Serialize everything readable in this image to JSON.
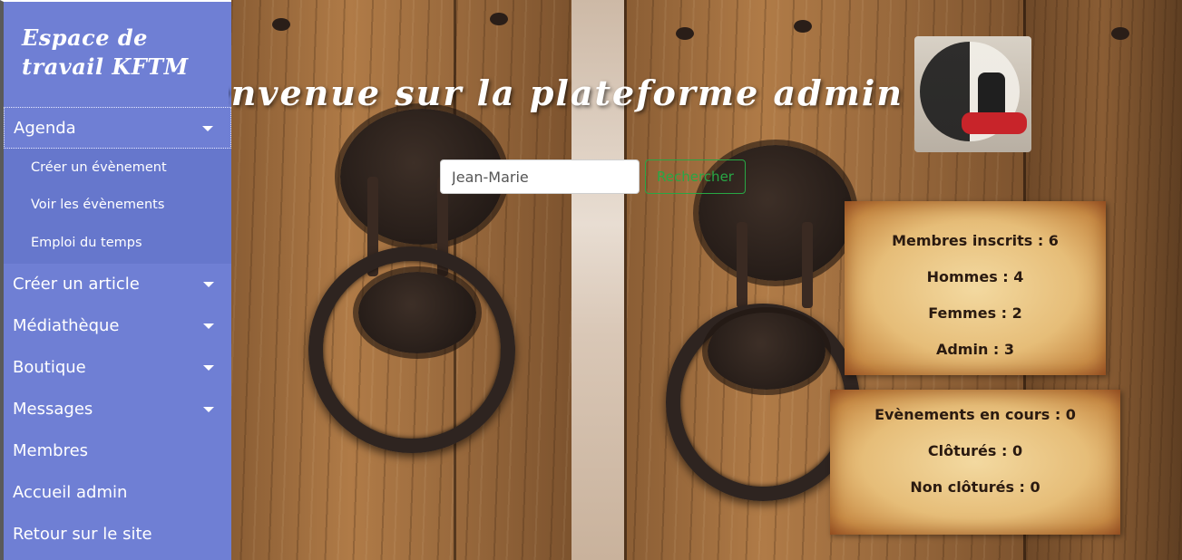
{
  "sidebar": {
    "title": "Espace de travail KFTM",
    "menu": [
      {
        "label": "Agenda",
        "has_caret": true,
        "submenu": [
          "Créer un évènement",
          "Voir les évènements",
          "Emploi du temps"
        ]
      },
      {
        "label": "Créer un article",
        "has_caret": true
      },
      {
        "label": "Médiathèque",
        "has_caret": true
      },
      {
        "label": "Boutique",
        "has_caret": true
      },
      {
        "label": "Messages",
        "has_caret": true
      },
      {
        "label": "Membres",
        "has_caret": false
      },
      {
        "label": "Accueil admin",
        "has_caret": false
      },
      {
        "label": "Retour sur le site",
        "has_caret": false
      }
    ]
  },
  "main": {
    "welcome_title": "Bienvenue sur la plateforme admin",
    "search": {
      "value": "Jean-Marie",
      "button_label": "Rechercher"
    },
    "members_stats": {
      "registered": "Membres inscrits : 6",
      "men": "Hommes : 4",
      "women": "Femmes : 2",
      "admins": "Admin : 3"
    },
    "events_stats": {
      "ongoing": "Evènements en cours : 0",
      "closed": "Clôturés : 0",
      "not_closed": "Non clôturés : 0"
    }
  },
  "colors": {
    "sidebar_bg": "#6f7fd4",
    "search_button": "#28a745",
    "parchment": "#e6bd78"
  }
}
